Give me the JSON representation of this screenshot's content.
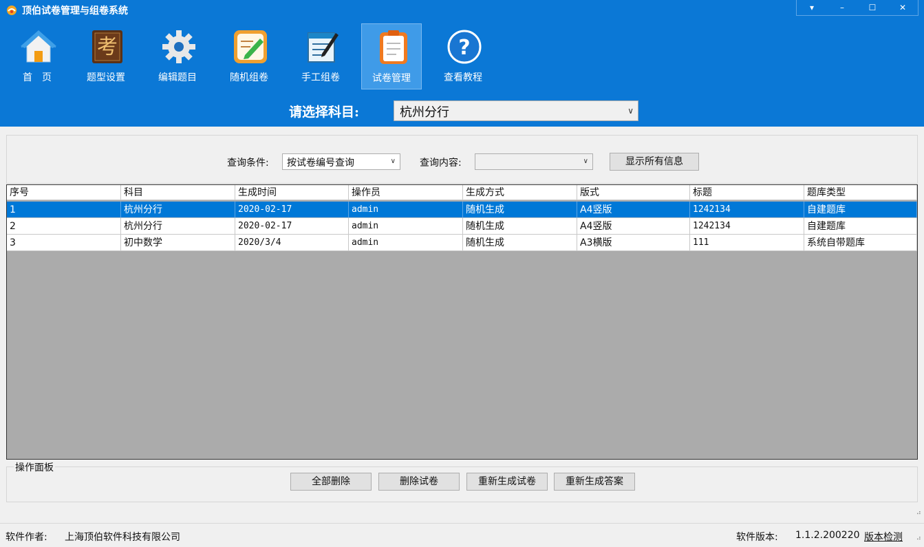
{
  "window": {
    "title": "顶伯试卷管理与组卷系统",
    "controls": [
      "▾",
      "–",
      "☐",
      "✕"
    ]
  },
  "toolbar": {
    "items": [
      {
        "label": "首　页",
        "icon": "home-icon"
      },
      {
        "label": "题型设置",
        "icon": "kao-book-icon"
      },
      {
        "label": "编辑题目",
        "icon": "gear-icon"
      },
      {
        "label": "随机组卷",
        "icon": "pencil-paper-icon"
      },
      {
        "label": "手工组卷",
        "icon": "notepad-pen-icon"
      },
      {
        "label": "试卷管理",
        "icon": "clipboard-icon"
      },
      {
        "label": "查看教程",
        "icon": "help-icon"
      }
    ],
    "active": "试卷管理"
  },
  "subject": {
    "label": "请选择科目:",
    "value": "杭州分行"
  },
  "query": {
    "condition_label": "查询条件:",
    "condition_value": "按试卷编号查询",
    "content_label": "查询内容:",
    "content_value": "",
    "show_all_label": "显示所有信息"
  },
  "grid": {
    "columns": [
      "序号",
      "科目",
      "生成时间",
      "操作员",
      "生成方式",
      "版式",
      "标题",
      "题库类型"
    ],
    "rows": [
      [
        "1",
        "杭州分行",
        "2020-02-17",
        "admin",
        "随机生成",
        "A4竖版",
        "1242134",
        "自建题库"
      ],
      [
        "2",
        "杭州分行",
        "2020-02-17",
        "admin",
        "随机生成",
        "A4竖版",
        "1242134",
        "自建题库"
      ],
      [
        "3",
        "初中数学",
        "2020/3/4",
        "admin",
        "随机生成",
        "A3横版",
        "111",
        "系统自带题库"
      ]
    ],
    "selected_row": 0
  },
  "panel": {
    "label": "操作面板",
    "buttons": [
      "全部删除",
      "删除试卷",
      "重新生成试卷",
      "重新生成答案"
    ]
  },
  "status": {
    "author_label": "软件作者:",
    "author_value": "上海顶伯软件科技有限公司",
    "version_label": "软件版本:",
    "version_value": "1.1.2.200220",
    "check_label": "版本检测"
  },
  "colors": {
    "titlebar": "#0b78d6",
    "selection": "#0078d7",
    "grid_background": "#ababab"
  }
}
